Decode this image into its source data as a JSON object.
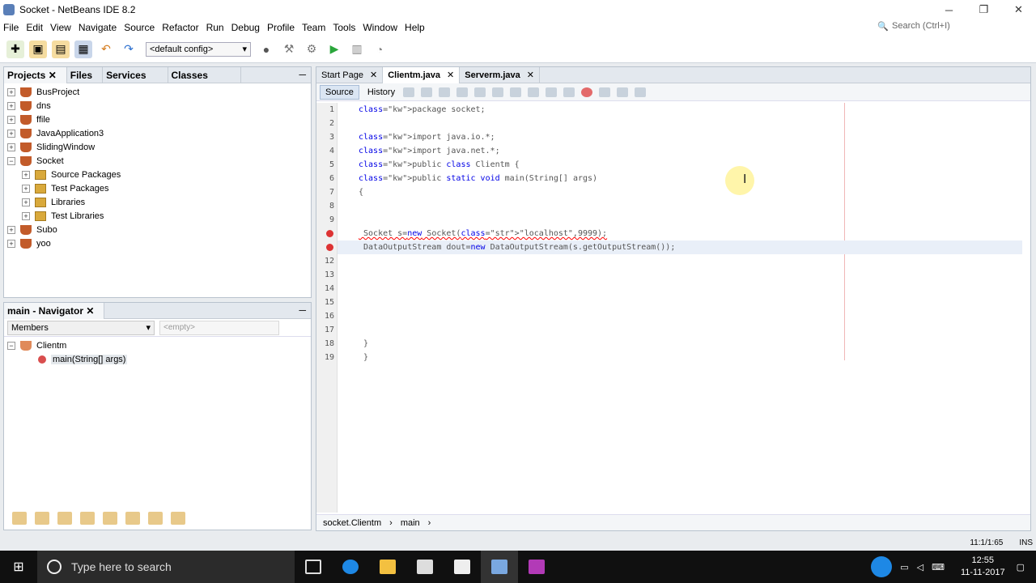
{
  "window": {
    "title": "Socket - NetBeans IDE 8.2"
  },
  "menu": [
    "File",
    "Edit",
    "View",
    "Navigate",
    "Source",
    "Refactor",
    "Run",
    "Debug",
    "Profile",
    "Team",
    "Tools",
    "Window",
    "Help"
  ],
  "search": {
    "placeholder": "Search (Ctrl+I)"
  },
  "toolbar": {
    "config": "<default config>"
  },
  "projects_panel": {
    "tabs": [
      "Projects",
      "Files",
      "Services",
      "Classes"
    ],
    "items": [
      {
        "label": "BusProject",
        "level": 0,
        "type": "project"
      },
      {
        "label": "dns",
        "level": 0,
        "type": "project"
      },
      {
        "label": "ffile",
        "level": 0,
        "type": "project"
      },
      {
        "label": "JavaApplication3",
        "level": 0,
        "type": "project"
      },
      {
        "label": "SlidingWindow",
        "level": 0,
        "type": "project"
      },
      {
        "label": "Socket",
        "level": 0,
        "type": "project"
      },
      {
        "label": "Source Packages",
        "level": 1,
        "type": "folder"
      },
      {
        "label": "Test Packages",
        "level": 1,
        "type": "folder"
      },
      {
        "label": "Libraries",
        "level": 1,
        "type": "folder"
      },
      {
        "label": "Test Libraries",
        "level": 1,
        "type": "folder"
      },
      {
        "label": "Subo",
        "level": 0,
        "type": "project"
      },
      {
        "label": "yoo",
        "level": 0,
        "type": "project"
      }
    ]
  },
  "navigator": {
    "title": "main - Navigator",
    "filter": "Members",
    "filter_placeholder": "<empty>",
    "class_name": "Clientm",
    "method": "main(String[] args)"
  },
  "editor": {
    "tabs": [
      {
        "label": "Start Page",
        "active": false
      },
      {
        "label": "Clientm.java",
        "active": true
      },
      {
        "label": "Serverm.java",
        "active": false
      }
    ],
    "modes": [
      "Source",
      "History"
    ],
    "lines": [
      {
        "n": "1",
        "text": "package socket;"
      },
      {
        "n": "2",
        "text": ""
      },
      {
        "n": "3",
        "text": "import java.io.*;"
      },
      {
        "n": "4",
        "text": "import java.net.*;"
      },
      {
        "n": "5",
        "text": "public class Clientm {"
      },
      {
        "n": "6",
        "text": "public static void main(String[] args)"
      },
      {
        "n": "7",
        "text": "{"
      },
      {
        "n": "8",
        "text": ""
      },
      {
        "n": "9",
        "text": ""
      },
      {
        "n": "",
        "text": " Socket s=new Socket(\"localhost\",9999);"
      },
      {
        "n": "",
        "text": " DataOutputStream dout=new DataOutputStream(s.getOutputStream());"
      },
      {
        "n": "12",
        "text": ""
      },
      {
        "n": "13",
        "text": ""
      },
      {
        "n": "14",
        "text": ""
      },
      {
        "n": "15",
        "text": ""
      },
      {
        "n": "16",
        "text": ""
      },
      {
        "n": "17",
        "text": ""
      },
      {
        "n": "18",
        "text": " }"
      },
      {
        "n": "19",
        "text": " }"
      }
    ],
    "breadcrumbs": [
      "socket.Clientm",
      "main"
    ]
  },
  "status": {
    "position": "11:1/1:65",
    "mode": "INS"
  },
  "taskbar": {
    "search_placeholder": "Type here to search",
    "time": "12:55",
    "date": "11-11-2017"
  },
  "colors": {
    "keyword": "#0000e6",
    "string": "#ce7b00",
    "error": "#ff0000"
  }
}
